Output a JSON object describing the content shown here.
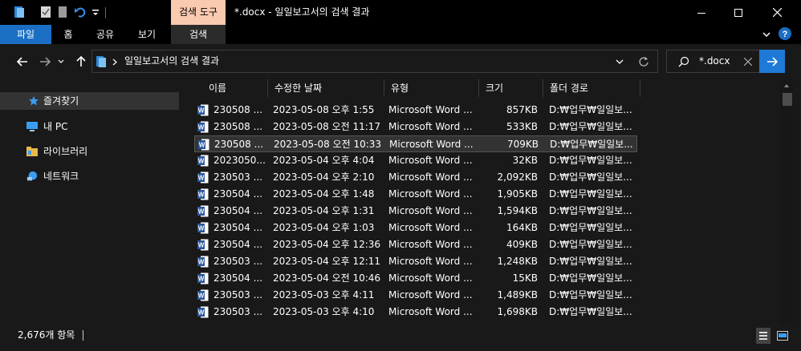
{
  "window": {
    "context_tab": "검색 도구",
    "title": "*.docx - 일일보고서의 검색 결과"
  },
  "ribbon": {
    "tabs": [
      "파일",
      "홈",
      "공유",
      "보기",
      "검색"
    ]
  },
  "address": {
    "path": "일일보고서의 검색 결과"
  },
  "search": {
    "value": "*.docx"
  },
  "sidebar": {
    "items": [
      "즐겨찾기",
      "내 PC",
      "라이브러리",
      "네트워크"
    ]
  },
  "columns": [
    "이름",
    "수정한 날짜",
    "유형",
    "크기",
    "폴더 경로"
  ],
  "rows": [
    {
      "name": "230508 ...",
      "date": "2023-05-08 오후 1:55",
      "type": "Microsoft Word ...",
      "size": "857KB",
      "path": "D:₩업무₩일일보..."
    },
    {
      "name": "230508 ...",
      "date": "2023-05-08 오전 11:17",
      "type": "Microsoft Word ...",
      "size": "533KB",
      "path": "D:₩업무₩일일보..."
    },
    {
      "name": "230508 ...",
      "date": "2023-05-08 오전 10:33",
      "type": "Microsoft Word ...",
      "size": "709KB",
      "path": "D:₩업무₩일일보..."
    },
    {
      "name": "2023050...",
      "date": "2023-05-04 오후 4:04",
      "type": "Microsoft Word ...",
      "size": "32KB",
      "path": "D:₩업무₩일일보..."
    },
    {
      "name": "230503 ...",
      "date": "2023-05-04 오후 2:10",
      "type": "Microsoft Word ...",
      "size": "2,092KB",
      "path": "D:₩업무₩일일보..."
    },
    {
      "name": "230504 ...",
      "date": "2023-05-04 오후 1:48",
      "type": "Microsoft Word ...",
      "size": "1,905KB",
      "path": "D:₩업무₩일일보..."
    },
    {
      "name": "230504 ...",
      "date": "2023-05-04 오후 1:31",
      "type": "Microsoft Word ...",
      "size": "1,594KB",
      "path": "D:₩업무₩일일보..."
    },
    {
      "name": "230504 ...",
      "date": "2023-05-04 오후 1:03",
      "type": "Microsoft Word ...",
      "size": "164KB",
      "path": "D:₩업무₩일일보..."
    },
    {
      "name": "230504 ...",
      "date": "2023-05-04 오후 12:36",
      "type": "Microsoft Word ...",
      "size": "409KB",
      "path": "D:₩업무₩일일보..."
    },
    {
      "name": "230503 ...",
      "date": "2023-05-04 오후 12:11",
      "type": "Microsoft Word ...",
      "size": "1,248KB",
      "path": "D:₩업무₩일일보..."
    },
    {
      "name": "230504 ...",
      "date": "2023-05-04 오전 10:46",
      "type": "Microsoft Word ...",
      "size": "15KB",
      "path": "D:₩업무₩일일보..."
    },
    {
      "name": "230503 ...",
      "date": "2023-05-03 오후 4:11",
      "type": "Microsoft Word ...",
      "size": "1,489KB",
      "path": "D:₩업무₩일일보..."
    },
    {
      "name": "230503 ...",
      "date": "2023-05-03 오후 4:10",
      "type": "Microsoft Word ...",
      "size": "1,698KB",
      "path": "D:₩업무₩일일보..."
    }
  ],
  "selected_row": 2,
  "status": {
    "count": "2,676개 항목"
  },
  "colors": {
    "accent": "#1a6fc4",
    "context_tab": "#f9c9b0",
    "background": "#191919"
  }
}
